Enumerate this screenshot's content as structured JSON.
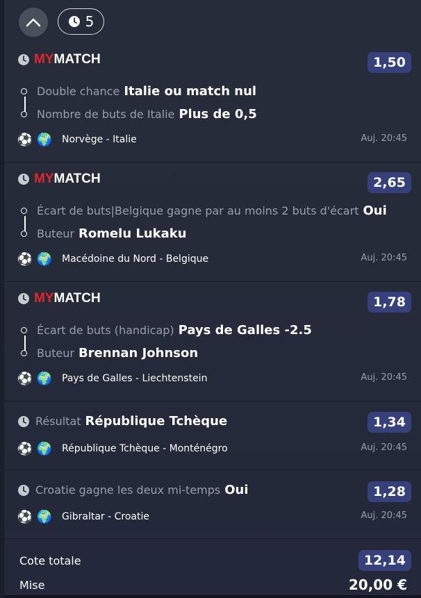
{
  "header": {
    "count": "5"
  },
  "logo": {
    "my": "MY",
    "match": "MATCH"
  },
  "bets": [
    {
      "odds": "1,50",
      "legs": [
        {
          "market": "Double chance",
          "selection": "Italie ou match nul"
        },
        {
          "market": "Nombre de buts de Italie",
          "selection": "Plus de 0,5"
        }
      ],
      "event": "Norvège - Italie",
      "time": "Auj. 20:45"
    },
    {
      "odds": "2,65",
      "legs": [
        {
          "market": "Écart de buts|Belgique gagne par au moins 2 buts d'écart",
          "selection": "Oui"
        },
        {
          "market": "Buteur",
          "selection": "Romelu Lukaku"
        }
      ],
      "event": "Macédoine du Nord - Belgique",
      "time": "Auj. 20:45"
    },
    {
      "odds": "1,78",
      "legs": [
        {
          "market": "Écart de buts (handicap)",
          "selection": "Pays de Galles -2.5"
        },
        {
          "market": "Buteur",
          "selection": "Brennan Johnson"
        }
      ],
      "event": "Pays de Galles - Liechtenstein",
      "time": "Auj. 20:45"
    },
    {
      "odds": "1,34",
      "market": "Résultat",
      "selection": "République Tchèque",
      "event": "République Tchèque - Monténégro",
      "time": "Auj. 20:45"
    },
    {
      "odds": "1,28",
      "market": "Croatie gagne les deux mi-temps",
      "selection": "Oui",
      "event": "Gibraltar - Croatie",
      "time": "Auj. 20:45"
    }
  ],
  "footer": {
    "total_label": "Cote totale",
    "total_odds": "12,14",
    "stake_label": "Mise",
    "stake_value": "20,00 €"
  },
  "icons": {
    "sport": "soccer-ball-icon",
    "globe": "globe-icon",
    "clock": "clock-icon"
  },
  "colors": {
    "odds_bg": "#36407a",
    "logo_red": "#e3262c",
    "panel_bg": "#262b3a"
  }
}
